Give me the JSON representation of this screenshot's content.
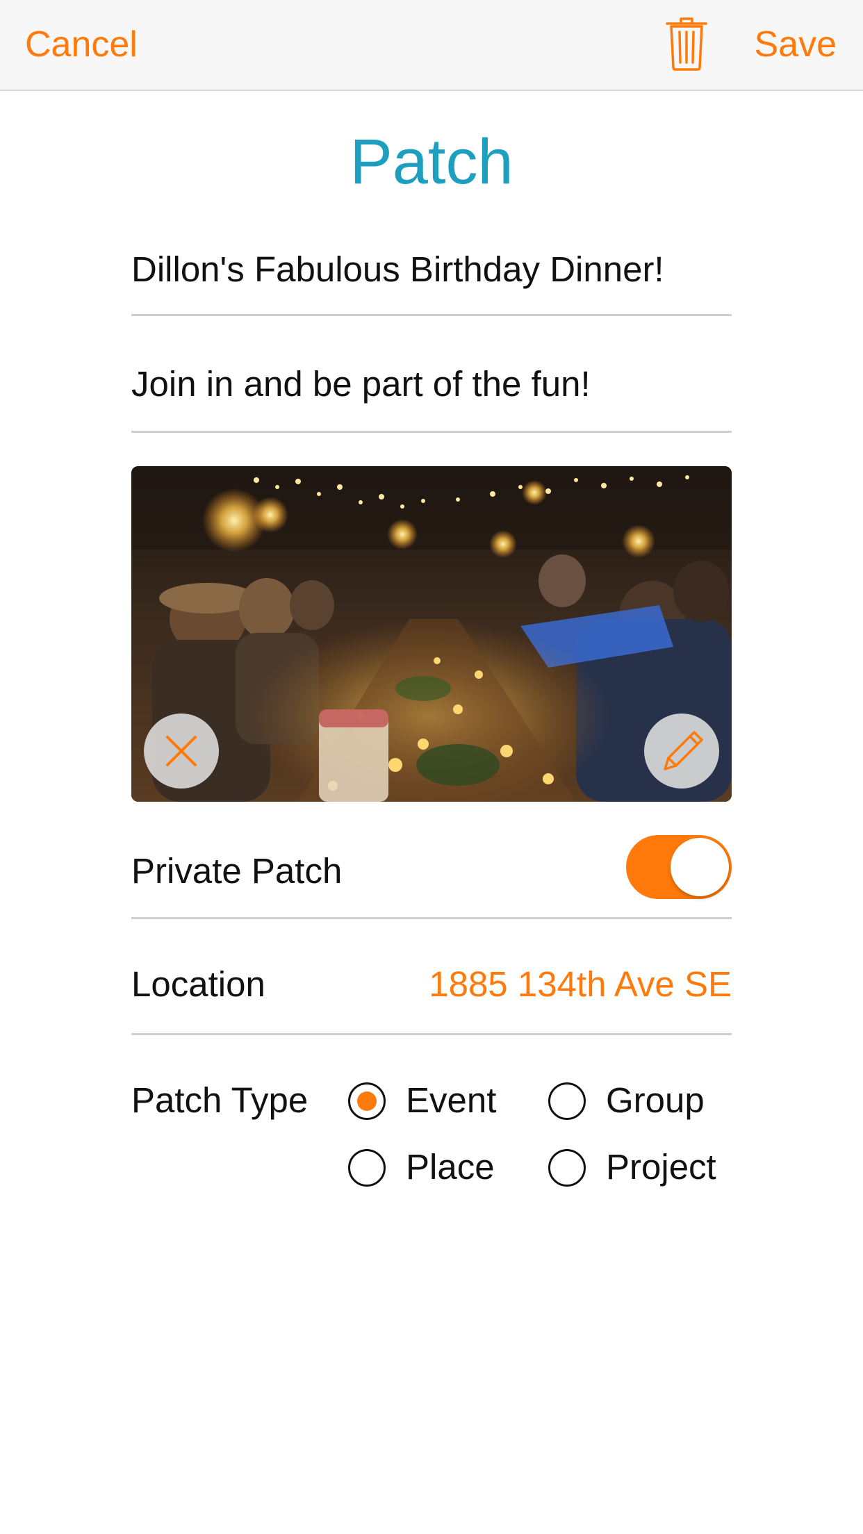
{
  "navbar": {
    "cancel_label": "Cancel",
    "save_label": "Save",
    "trash_icon": "trash-icon"
  },
  "title": "Patch",
  "form": {
    "name_value": "Dillon's Fabulous Birthday Dinner!",
    "description_value": "Join in and be part of the fun!",
    "photo": {
      "remove_icon": "close-icon",
      "edit_icon": "pencil-icon"
    },
    "private": {
      "label": "Private Patch",
      "enabled": true
    },
    "location": {
      "label": "Location",
      "value": "1885 134th Ave SE"
    },
    "patch_type": {
      "label": "Patch Type",
      "options": [
        "Event",
        "Group",
        "Place",
        "Project"
      ],
      "selected": "Event"
    }
  },
  "colors": {
    "accent": "#ff7a0a",
    "title": "#1f9fbf",
    "divider": "#cfcfcf"
  }
}
